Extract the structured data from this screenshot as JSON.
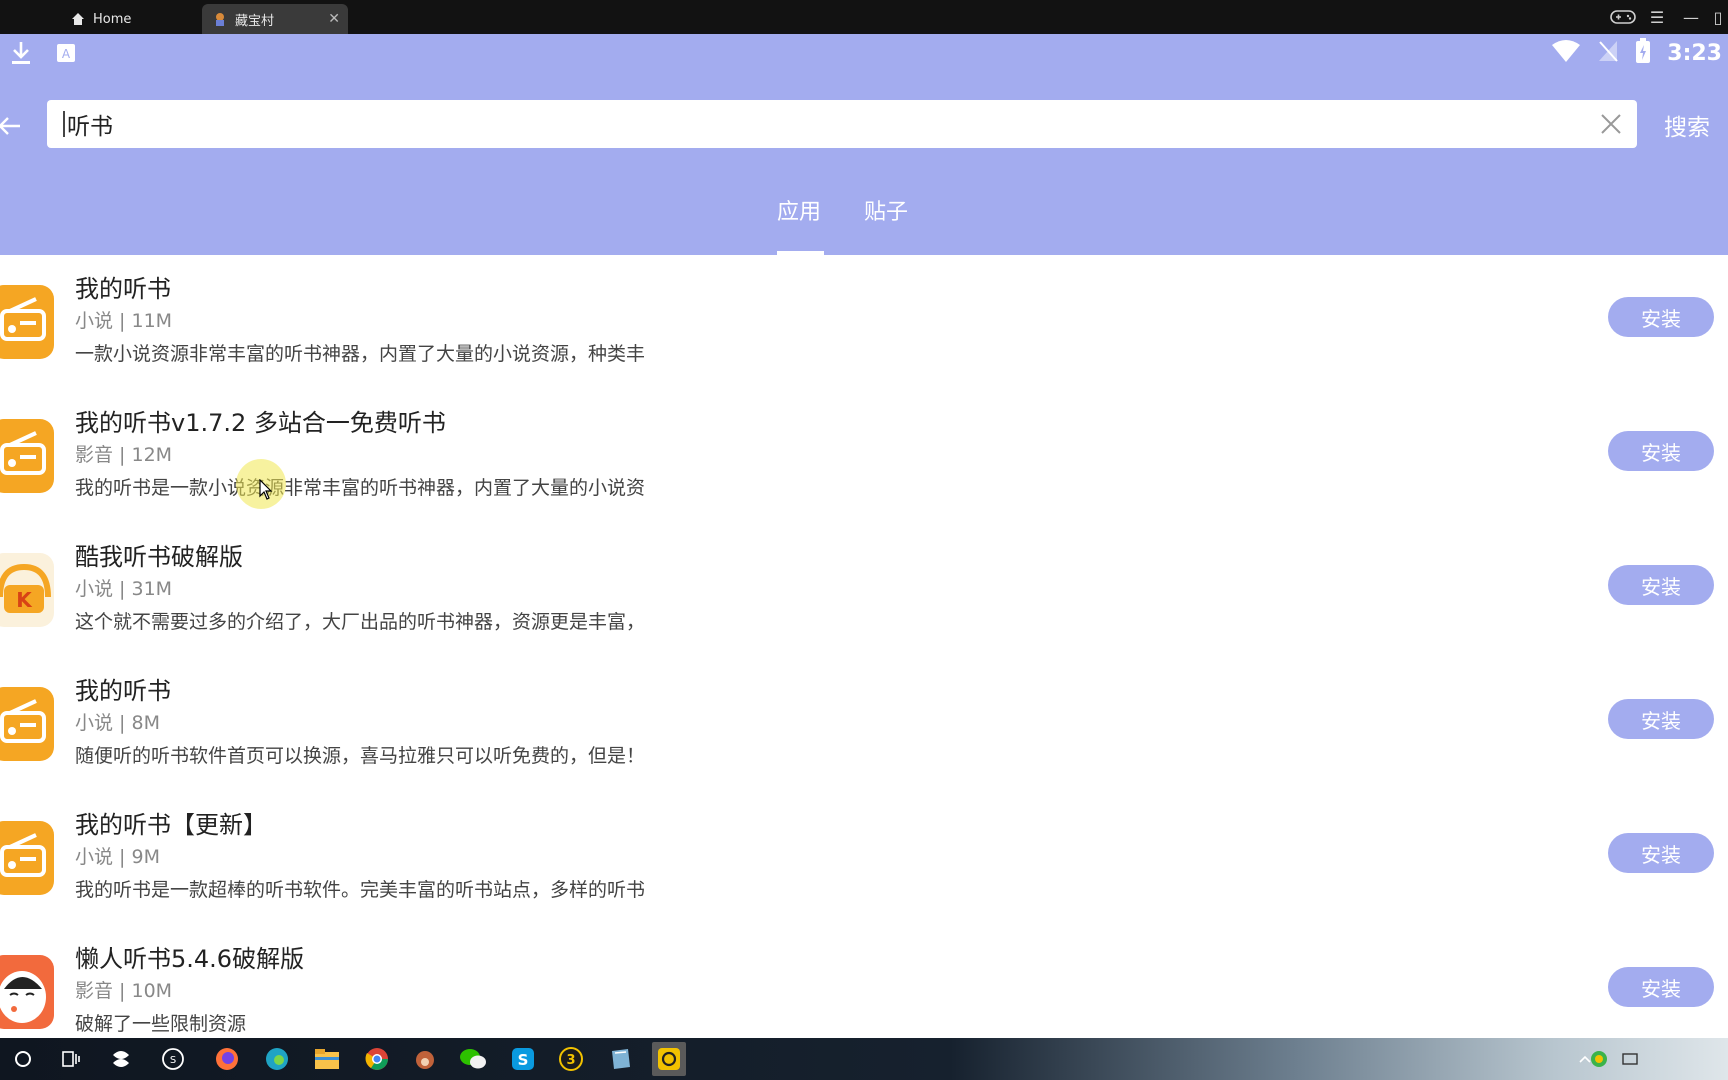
{
  "window": {
    "tabs": [
      {
        "label": "Home",
        "icon": "home-icon"
      },
      {
        "label": "藏宝村",
        "icon": "app-favicon"
      }
    ]
  },
  "status_bar": {
    "time": "3:23"
  },
  "search": {
    "value": "听书",
    "submit_label": "搜索"
  },
  "result_tabs": [
    {
      "label": "应用",
      "selected": true
    },
    {
      "label": "贴子",
      "selected": false
    }
  ],
  "apps": [
    {
      "title": "我的听书",
      "meta": "小说 | 11M",
      "desc": "一款小说资源非常丰富的听书神器，内置了大量的小说资源，种类丰",
      "action": "安装",
      "icon": "radio-icon"
    },
    {
      "title": "我的听书v1.7.2 多站合一免费听书",
      "meta": "影音 | 12M",
      "desc": "我的听书是一款小说资源非常丰富的听书神器，内置了大量的小说资",
      "action": "安装",
      "icon": "radio-icon"
    },
    {
      "title": "酷我听书破解版",
      "meta": "小说 | 31M",
      "desc": "这个就不需要过多的介绍了，大厂出品的听书神器，资源更是丰富，",
      "action": "安装",
      "icon": "kuwo-headphones-icon"
    },
    {
      "title": "我的听书",
      "meta": "小说 | 8M",
      "desc": "随便听的听书软件首页可以换源，喜马拉雅只可以听免费的，但是！",
      "action": "安装",
      "icon": "radio-icon"
    },
    {
      "title": "我的听书【更新】",
      "meta": "小说 | 9M",
      "desc": "我的听书是一款超棒的听书软件。完美丰富的听书站点，多样的听书",
      "action": "安装",
      "icon": "radio-icon"
    },
    {
      "title": "懒人听书5.4.6破解版",
      "meta": "影音 | 10M",
      "desc": "破解了一些限制资源",
      "action": "安装",
      "icon": "lazy-face-icon"
    }
  ],
  "colors": {
    "accent": "#a3acef",
    "icon_orange": "#f5a623"
  }
}
